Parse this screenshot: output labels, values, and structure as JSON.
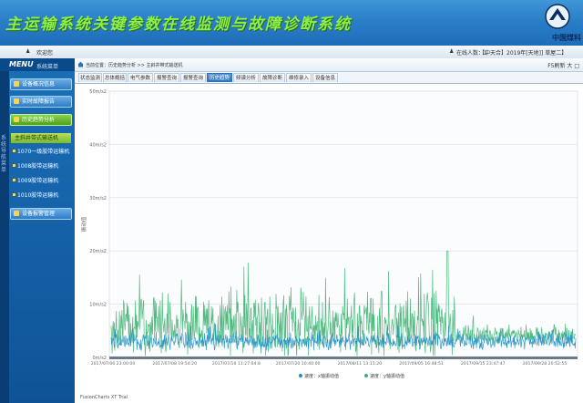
{
  "banner": {
    "title": "主运输系统关键参数在线监测与故障诊断系统",
    "brand": "中国煤科"
  },
  "topbar": {
    "left_text": "欢迎您",
    "online_text": "在线人数：1",
    "location_text": "【中天合】2019年[天地]] 草屋二】"
  },
  "sidebar": {
    "menu_label": "MENU",
    "menu_sub": "系统菜单",
    "strip_text": "系统导航菜单",
    "sections": [
      {
        "label": "设备概况信息",
        "active": false
      },
      {
        "label": "实时故障报告",
        "active": false
      },
      {
        "label": "历史趋势分析",
        "active": true
      }
    ],
    "subitems": [
      {
        "label": "主斜井带式输送机",
        "selected": true
      },
      {
        "label": "1070一级胶带运输机",
        "selected": false
      },
      {
        "label": "1008胶带运输机",
        "selected": false
      },
      {
        "label": "1009胶带运输机",
        "selected": false
      },
      {
        "label": "1010胶带运输机",
        "selected": false
      }
    ],
    "bottom_section": "设备报警管理"
  },
  "breadcrumb": {
    "text": "当前位置：历史趋势分析 >> 主斜井带式输送机",
    "right_text": "F5刷新 大 □"
  },
  "tabs": [
    {
      "label": "状态监测",
      "active": false
    },
    {
      "label": "总体概括",
      "active": false
    },
    {
      "label": "电气参数",
      "active": false
    },
    {
      "label": "报警查询",
      "active": false
    },
    {
      "label": "报警查询",
      "active": false
    },
    {
      "label": "历史趋势",
      "active": true
    },
    {
      "label": "频谱分析",
      "active": false
    },
    {
      "label": "故障诊断",
      "active": false
    },
    {
      "label": "维修录入",
      "active": false
    },
    {
      "label": "设备信息",
      "active": false
    }
  ],
  "footer": {
    "text": "FusionCharts XT Trial"
  },
  "colors": {
    "green_series": "#3cb371",
    "blue_series": "#1f8fc4",
    "tab_active": "#2d6fb5",
    "banner_title": "#8df04a"
  },
  "chart_data": {
    "type": "line",
    "title": "",
    "xlabel": "",
    "ylabel": "振动值",
    "y_unit": "m/s2",
    "ylim": [
      0,
      50
    ],
    "y_ticks": [
      "0m/s2",
      "10m/s2",
      "20m/s2",
      "30m/s2",
      "40m/s2",
      "50m/s2"
    ],
    "x_ticks": [
      "2017/07/06 23:00:00",
      "2017/07/08 19:54:20",
      "2017/07/10 11:27:04:8",
      "2017/07/20 10:40:00",
      "2017/08/11 13:11:20",
      "2017/09/05 16:48:51",
      "2017/09/15 23:47:47",
      "2017/09/28 20:52:55"
    ],
    "series": [
      {
        "name": "速度：x轴振动值",
        "color": "#1f8fc4",
        "baseline": 3,
        "spread": 2.5,
        "peak": 6
      },
      {
        "name": "速度：y轴振动值",
        "color": "#3cb371",
        "baseline": 6,
        "spread": 9,
        "peak": 20
      }
    ]
  }
}
